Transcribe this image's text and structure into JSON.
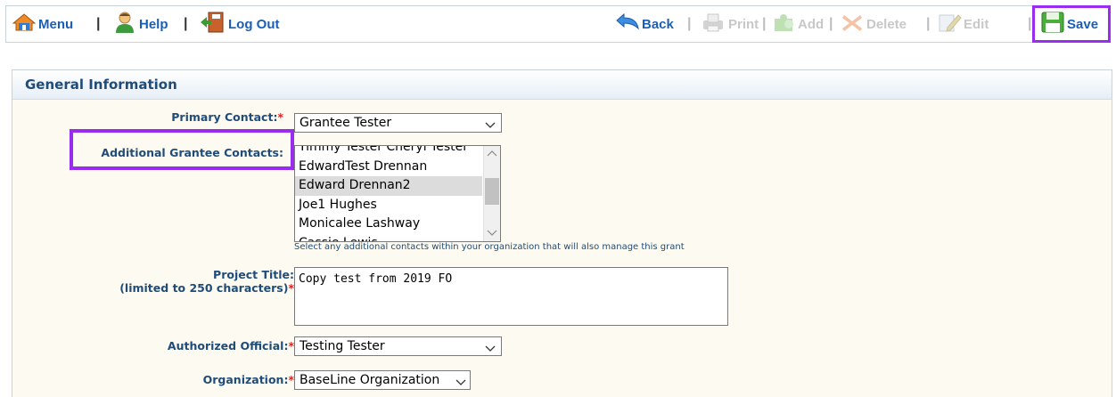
{
  "toolbar": {
    "menu": "Menu",
    "help": "Help",
    "logout": "Log Out",
    "back": "Back",
    "print": "Print",
    "add": "Add",
    "delete": "Delete",
    "edit": "Edit",
    "save": "Save",
    "separator": "|"
  },
  "panel": {
    "title": "General Information"
  },
  "form": {
    "required_mark": "*",
    "primary_contact": {
      "label": "Primary Contact:",
      "value": "Grantee Tester"
    },
    "additional_contacts": {
      "label": "Additional Grantee Contacts:",
      "options": [
        "Timmy Tester Cheryl Tester",
        "EdwardTest Drennan",
        "Edward Drennan2",
        "Joe1 Hughes",
        "Monicalee Lashway",
        "Cassie Lewis"
      ],
      "selected": "Edward Drennan2",
      "helper": "Select any additional contacts within your organization that will also manage this grant"
    },
    "project_title": {
      "label_line1": "Project Title:",
      "label_line2": "(limited to 250 characters)",
      "value": "Copy test from 2019 FO"
    },
    "authorized_official": {
      "label": "Authorized Official:",
      "value": "Testing Tester"
    },
    "organization": {
      "label": "Organization:",
      "value": "BaseLine Organization"
    }
  },
  "colors": {
    "link_blue": "#1a5fb4",
    "label_navy": "#1f4c79",
    "required_red": "#e02020",
    "highlight_purple": "#9a2cf0",
    "panel_bg": "#fdfbf1"
  },
  "icons": {
    "menu": "home-icon",
    "help": "person-help-icon",
    "logout": "exit-door-icon",
    "back": "back-arrow-icon",
    "print": "print-icon",
    "add": "add-puzzle-icon",
    "delete": "delete-x-icon",
    "edit": "edit-pencil-icon",
    "save": "floppy-save-icon"
  }
}
